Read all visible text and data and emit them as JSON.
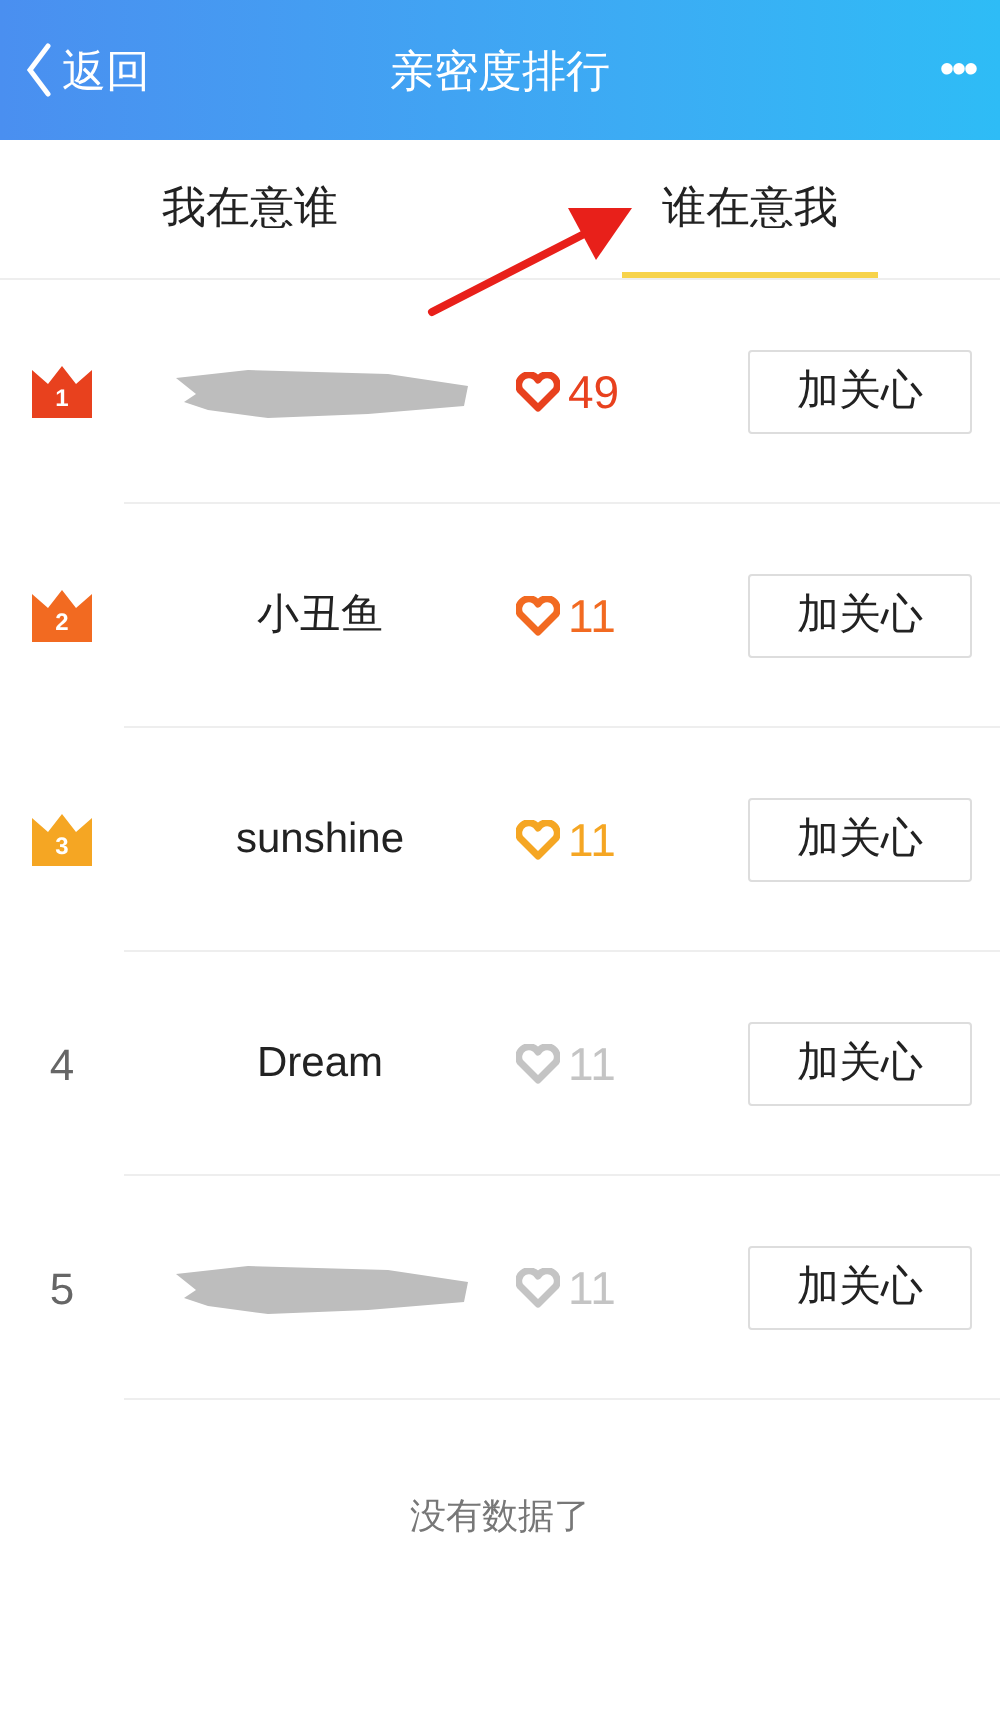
{
  "nav": {
    "back": "返回",
    "title": "亲密度排行",
    "more": "•••"
  },
  "tabs": [
    {
      "label": "我在意谁",
      "selected": false
    },
    {
      "label": "谁在意我",
      "selected": true
    }
  ],
  "rows": [
    {
      "rank": "1",
      "kind": "crown",
      "color": "#e8411e",
      "name_redacted": true,
      "count": "49",
      "button": "加关心"
    },
    {
      "rank": "2",
      "kind": "crown",
      "color": "#f26a21",
      "name": "小丑鱼",
      "count": "11",
      "button": "加关心"
    },
    {
      "rank": "3",
      "kind": "crown",
      "color": "#f5a623",
      "name": "sunshine",
      "count": "11",
      "button": "加关心"
    },
    {
      "rank": "4",
      "kind": "plain",
      "color": "#c4c4c4",
      "name": "Dream",
      "count": "11",
      "button": "加关心"
    },
    {
      "rank": "5",
      "kind": "plain",
      "color": "#c4c4c4",
      "name_redacted": true,
      "count": "11",
      "button": "加关心"
    }
  ],
  "footer": "没有数据了",
  "annotation": {
    "kind": "arrow"
  }
}
